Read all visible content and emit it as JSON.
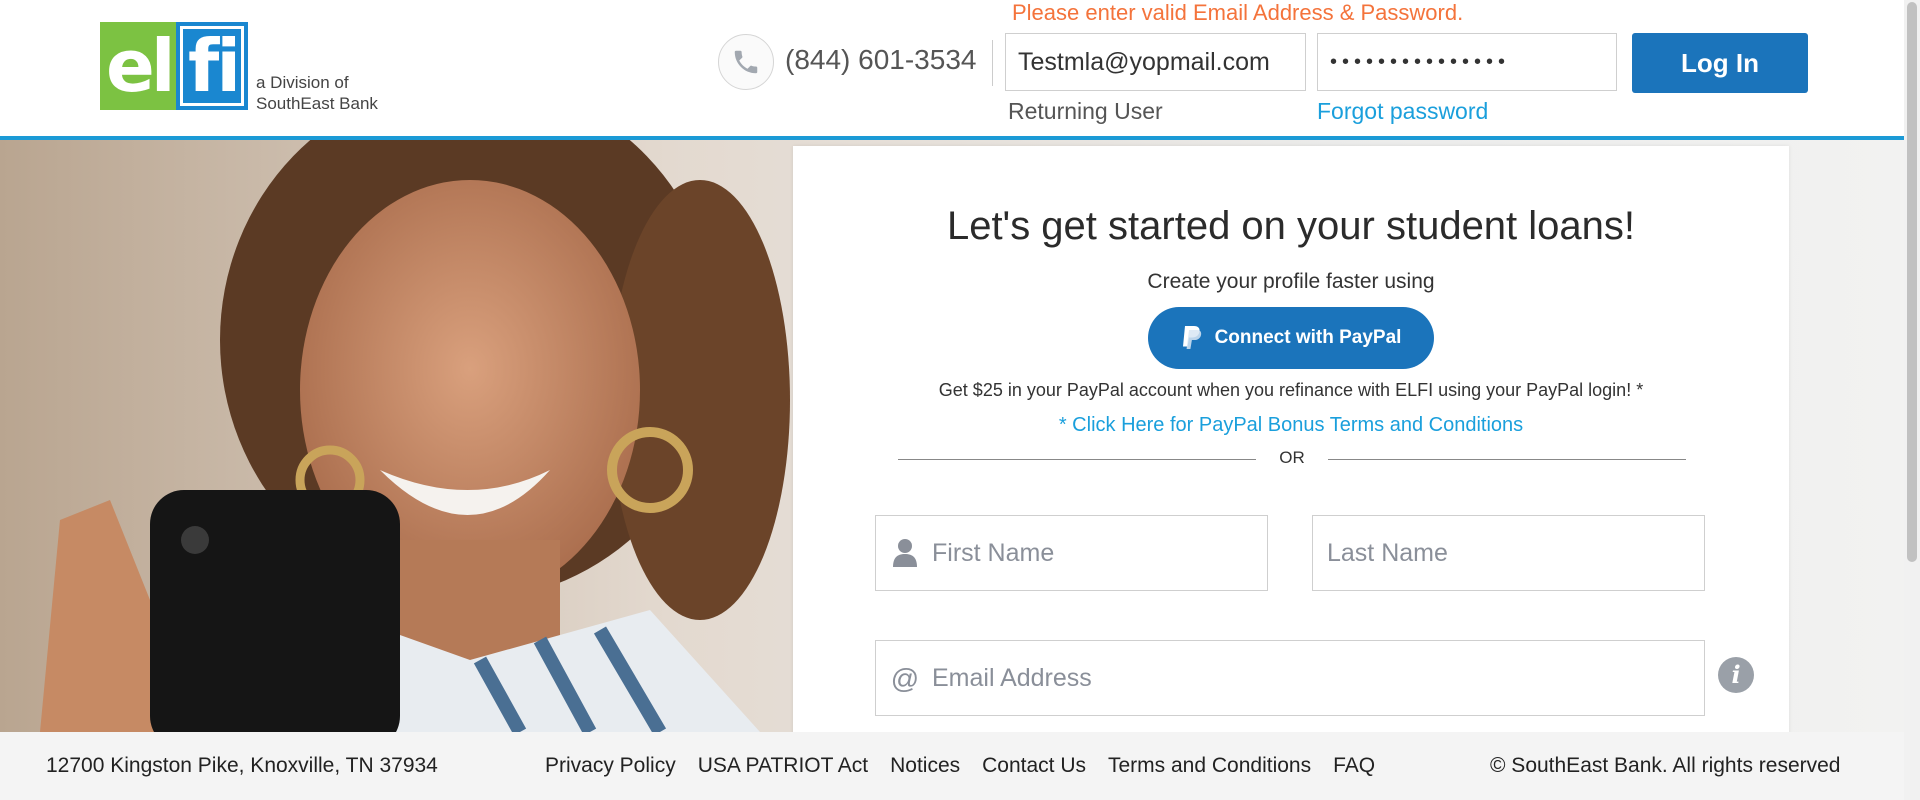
{
  "header": {
    "logo": {
      "letters_left": "el",
      "letters_right": "fi",
      "division_line1": "a Division of",
      "division_line2": "SouthEast Bank"
    },
    "phone": {
      "icon": "phone-icon",
      "number": "(844) 601-3534"
    },
    "login": {
      "error": "Please enter valid Email Address & Password.",
      "email_value": "Testmla@yopmail.com",
      "password_value": "•••••••••••••••",
      "login_label": "Log In",
      "returning_user": "Returning User",
      "forgot_password": "Forgot password"
    }
  },
  "signup": {
    "title": "Let's get started on your student loans!",
    "subtitle": "Create your profile faster using",
    "paypal_button": "Connect with PayPal",
    "paypal_note": "Get $25 in your PayPal account when you refinance with ELFI using your PayPal login! *",
    "paypal_terms": "* Click Here for PayPal Bonus Terms and Conditions",
    "or": "OR",
    "first_name_placeholder": "First Name",
    "last_name_placeholder": "Last Name",
    "email_placeholder": "Email Address",
    "email_icon_glyph": "@"
  },
  "footer": {
    "address": "12700 Kingston Pike, Knoxville, TN 37934",
    "links": [
      "Privacy Policy",
      "USA PATRIOT Act",
      "Notices",
      "Contact Us",
      "Terms and Conditions",
      "FAQ"
    ],
    "copyright": "© SouthEast Bank. All rights reserved"
  },
  "colors": {
    "brand_blue": "#1b74bb",
    "accent_blue": "#1b9ad6",
    "logo_green": "#7cc242",
    "error_orange": "#f4733b",
    "link_blue": "#1a9fdc"
  }
}
